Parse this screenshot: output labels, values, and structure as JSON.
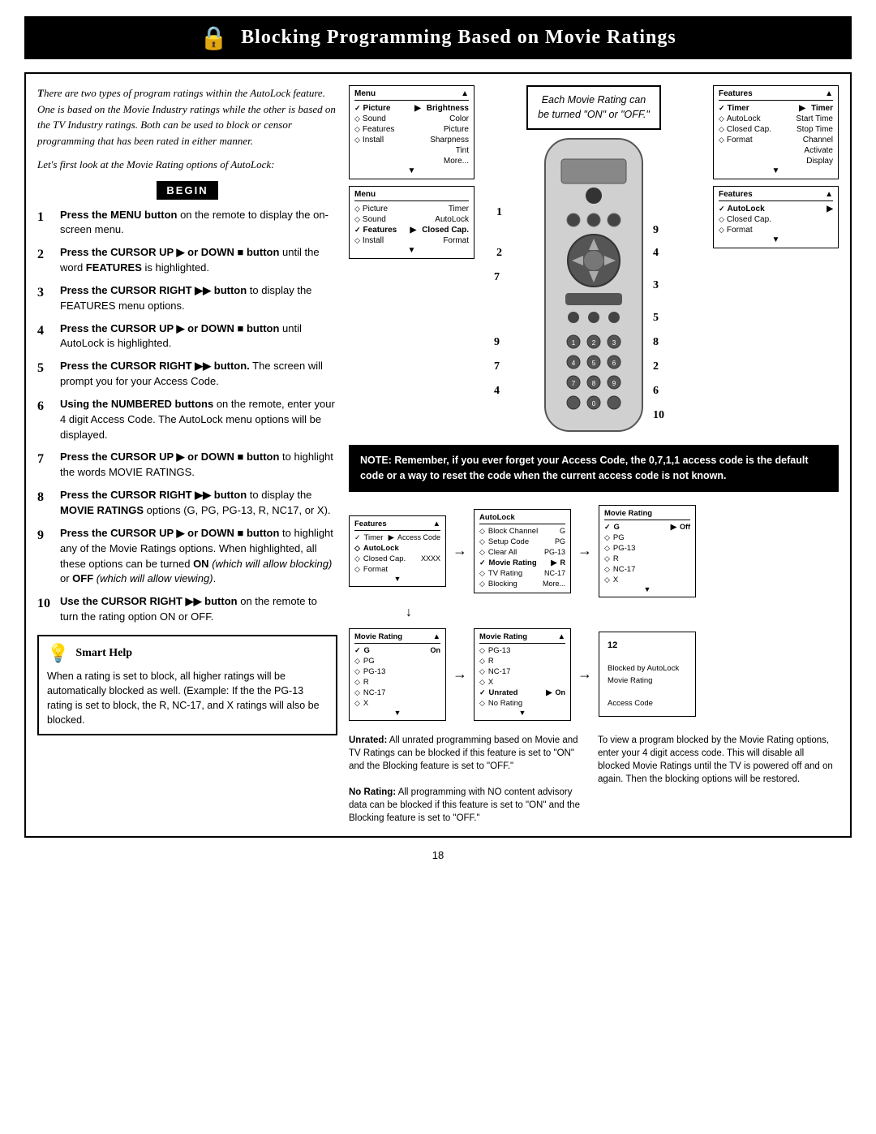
{
  "page": {
    "number": "18"
  },
  "header": {
    "title": "Blocking Programming Based on Movie Ratings",
    "lock_icon": "🔒"
  },
  "intro": {
    "paragraph1": "There are two types of program ratings within the AutoLock feature. One is based on the Movie Industry ratings while the other is based on the TV Industry ratings. Both can be used to block or censor programming that has been rated in either manner.",
    "paragraph2": "Let's first look at the Movie Rating options of AutoLock:"
  },
  "begin_label": "BEGIN",
  "steps": [
    {
      "num": "1",
      "text": "Press the MENU button on the remote to display the on-screen menu."
    },
    {
      "num": "2",
      "text": "Press the CURSOR UP ▶ or DOWN ■ button until the word FEATURES is highlighted."
    },
    {
      "num": "3",
      "text": "Press the CURSOR RIGHT ▶▶ button to display the FEATURES menu options."
    },
    {
      "num": "4",
      "text": "Press the CURSOR UP ▶ or DOWN ■ button until AutoLock is highlighted."
    },
    {
      "num": "5",
      "text": "Press the CURSOR RIGHT ▶▶ button. The screen will prompt you for your Access Code."
    },
    {
      "num": "6",
      "text": "Using the NUMBERED buttons on the remote, enter your 4 digit Access Code. The AutoLock menu options will be displayed."
    },
    {
      "num": "7",
      "text": "Press the CURSOR UP ▶ or DOWN ■ button to highlight the words MOVIE RATINGS."
    },
    {
      "num": "8",
      "text": "Press the CURSOR RIGHT ▶▶ button to display the MOVIE RATINGS options (G, PG, PG-13, R, NC17, or X)."
    },
    {
      "num": "9",
      "text": "Press the CURSOR UP ▶ or DOWN ■ button to highlight any of the Movie Ratings options. When highlighted, all these options can be turned ON (which will allow blocking) or OFF (which will allow viewing)."
    },
    {
      "num": "10",
      "text": "Use the CURSOR RIGHT ▶▶ button on the remote to turn the rating option ON or OFF."
    }
  ],
  "smart_help": {
    "title": "Smart Help",
    "text": "When a rating is set to block, all higher ratings will be automatically blocked as well. (Example: If the the PG-13 rating is set to block, the R, NC-17, and X ratings will also be blocked."
  },
  "movie_rating_callout": "Each Movie Rating can\nbe turned \"ON\" or \"OFF.\"",
  "note_box": {
    "text": "NOTE: Remember, if you ever forget your Access Code, the 0,7,1,1 access code is the default code or a way to reset the code when the current access code is not known."
  },
  "screen_panels_left": [
    {
      "id": "panel1",
      "header_left": "Menu",
      "header_right": "▲",
      "rows": [
        {
          "icon": "✓",
          "label": "Picture",
          "arrow": "▶",
          "value": "Brightness"
        },
        {
          "icon": "◇",
          "label": "Sound",
          "arrow": "",
          "value": "Color"
        },
        {
          "icon": "◇",
          "label": "Features",
          "arrow": "",
          "value": "Picture"
        },
        {
          "icon": "◇",
          "label": "Install",
          "arrow": "",
          "value": "Sharpness"
        },
        {
          "icon": "",
          "label": "",
          "arrow": "",
          "value": "Tint"
        },
        {
          "icon": "",
          "label": "",
          "arrow": "",
          "value": "More..."
        }
      ],
      "scroll": "▼"
    },
    {
      "id": "panel2",
      "header_left": "Menu",
      "header_right": "",
      "rows": [
        {
          "icon": "◇",
          "label": "Picture",
          "arrow": "",
          "value": "Timer"
        },
        {
          "icon": "◇",
          "label": "Sound",
          "arrow": "",
          "value": "AutoLock"
        },
        {
          "icon": "✓",
          "label": "Features",
          "arrow": "▶",
          "value": "Closed Cap."
        },
        {
          "icon": "◇",
          "label": "Install",
          "arrow": "",
          "value": "Format"
        }
      ],
      "scroll": "▼"
    }
  ],
  "screen_panels_right": [
    {
      "id": "rpanel1",
      "header_left": "Features",
      "header_right": "▲",
      "rows": [
        {
          "icon": "✓",
          "label": "Timer",
          "arrow": "▶",
          "value": "Timer"
        },
        {
          "icon": "◇",
          "label": "AutoLock",
          "arrow": "",
          "value": "Start Time"
        },
        {
          "icon": "◇",
          "label": "Closed Cap.",
          "arrow": "",
          "value": "Stop Time"
        },
        {
          "icon": "◇",
          "label": "Format",
          "arrow": "",
          "value": "Channel"
        },
        {
          "icon": "",
          "label": "",
          "arrow": "",
          "value": "Activate"
        },
        {
          "icon": "",
          "label": "",
          "arrow": "",
          "value": "Display"
        }
      ],
      "scroll": "▼"
    },
    {
      "id": "rpanel2",
      "header_left": "Features",
      "header_right": "▲",
      "rows": [
        {
          "icon": "✓",
          "label": "AutoLock",
          "arrow": "▶",
          "value": ""
        },
        {
          "icon": "◇",
          "label": "Closed Cap.",
          "arrow": "",
          "value": ""
        },
        {
          "icon": "◇",
          "label": "Format",
          "arrow": "",
          "value": ""
        }
      ],
      "scroll": "▼"
    }
  ],
  "flow_panels": {
    "row1": [
      {
        "header_left": "Features",
        "header_right": "▲",
        "rows": [
          {
            "icon": "✓",
            "label": "Timer",
            "arrow": "▶",
            "value": "Access Code"
          },
          {
            "icon": "◇",
            "label": "AutoLock",
            "arrow": "",
            "value": ""
          },
          {
            "icon": "◇",
            "label": "Closed Cap.",
            "arrow": "",
            "value": "XXXX"
          },
          {
            "icon": "◇",
            "label": "Format",
            "arrow": "",
            "value": ""
          }
        ],
        "scroll": "▼"
      },
      {
        "header_left": "AutoLock",
        "header_right": "",
        "rows": [
          {
            "icon": "◇",
            "label": "Block Channel",
            "arrow": "",
            "value": "G"
          },
          {
            "icon": "◇",
            "label": "Setup Code",
            "arrow": "",
            "value": "PG"
          },
          {
            "icon": "◇",
            "label": "Clear All",
            "arrow": "",
            "value": "PG-13"
          },
          {
            "icon": "✓",
            "label": "Movie Rating",
            "arrow": "▶",
            "value": "R"
          },
          {
            "icon": "◇",
            "label": "TV Rating",
            "arrow": "",
            "value": "NC-17"
          },
          {
            "icon": "◇",
            "label": "Blocking",
            "arrow": "",
            "value": "More..."
          }
        ],
        "scroll": ""
      },
      {
        "header_left": "Movie Rating",
        "header_right": "",
        "rows": [
          {
            "icon": "✓",
            "label": "G",
            "arrow": "▶",
            "value": "Off"
          },
          {
            "icon": "◇",
            "label": "PG",
            "arrow": "",
            "value": ""
          },
          {
            "icon": "◇",
            "label": "PG-13",
            "arrow": "",
            "value": ""
          },
          {
            "icon": "◇",
            "label": "R",
            "arrow": "",
            "value": ""
          },
          {
            "icon": "◇",
            "label": "NC-17",
            "arrow": "",
            "value": ""
          },
          {
            "icon": "◇",
            "label": "X",
            "arrow": "",
            "value": ""
          }
        ],
        "scroll": "▼"
      }
    ],
    "row2": [
      {
        "header_left": "Movie Rating",
        "header_right": "▲",
        "rows": [
          {
            "icon": "✓",
            "label": "G",
            "arrow": "",
            "value": "On"
          },
          {
            "icon": "◇",
            "label": "PG",
            "arrow": "",
            "value": ""
          },
          {
            "icon": "◇",
            "label": "PG-13",
            "arrow": "",
            "value": ""
          },
          {
            "icon": "◇",
            "label": "R",
            "arrow": "",
            "value": ""
          },
          {
            "icon": "◇",
            "label": "NC-17",
            "arrow": "",
            "value": ""
          },
          {
            "icon": "◇",
            "label": "X",
            "arrow": "",
            "value": ""
          }
        ],
        "scroll": "▼"
      },
      {
        "header_left": "Movie Rating",
        "header_right": "▲",
        "rows": [
          {
            "icon": "◇",
            "label": "PG-13",
            "arrow": "",
            "value": ""
          },
          {
            "icon": "◇",
            "label": "R",
            "arrow": "",
            "value": ""
          },
          {
            "icon": "◇",
            "label": "NC-17",
            "arrow": "",
            "value": ""
          },
          {
            "icon": "◇",
            "label": "X",
            "arrow": "",
            "value": ""
          },
          {
            "icon": "✓",
            "label": "Unrated",
            "arrow": "▶",
            "value": "On"
          },
          {
            "icon": "◇",
            "label": "No Rating",
            "arrow": "",
            "value": ""
          }
        ],
        "scroll": "▼"
      },
      {
        "special": true,
        "line1": "12",
        "line2": "Blocked by AutoLock",
        "line3": "Movie Rating",
        "line4": "",
        "line5": "Access Code"
      }
    ]
  },
  "bottom_texts": [
    {
      "label_bold": "Unrated:",
      "text": " All unrated programming based on Movie and TV Ratings can be blocked if this feature is set to \"ON\" and the Blocking feature is set to \"OFF.\""
    },
    {
      "label_bold": "No Rating:",
      "text": " All programming with NO content advisory data can be blocked if this feature is set to \"ON\" and the Blocking feature is set to \"OFF.\""
    },
    {
      "text": "To view a program blocked by the Movie Rating options, enter your 4 digit access code. This will disable all blocked Movie Ratings until the TV is powered off and on again. Then the blocking options will be restored."
    }
  ],
  "remote": {
    "numbers_on_remote": [
      "1",
      "2",
      "3",
      "4",
      "5",
      "6",
      "7",
      "8",
      "9",
      "10"
    ]
  }
}
